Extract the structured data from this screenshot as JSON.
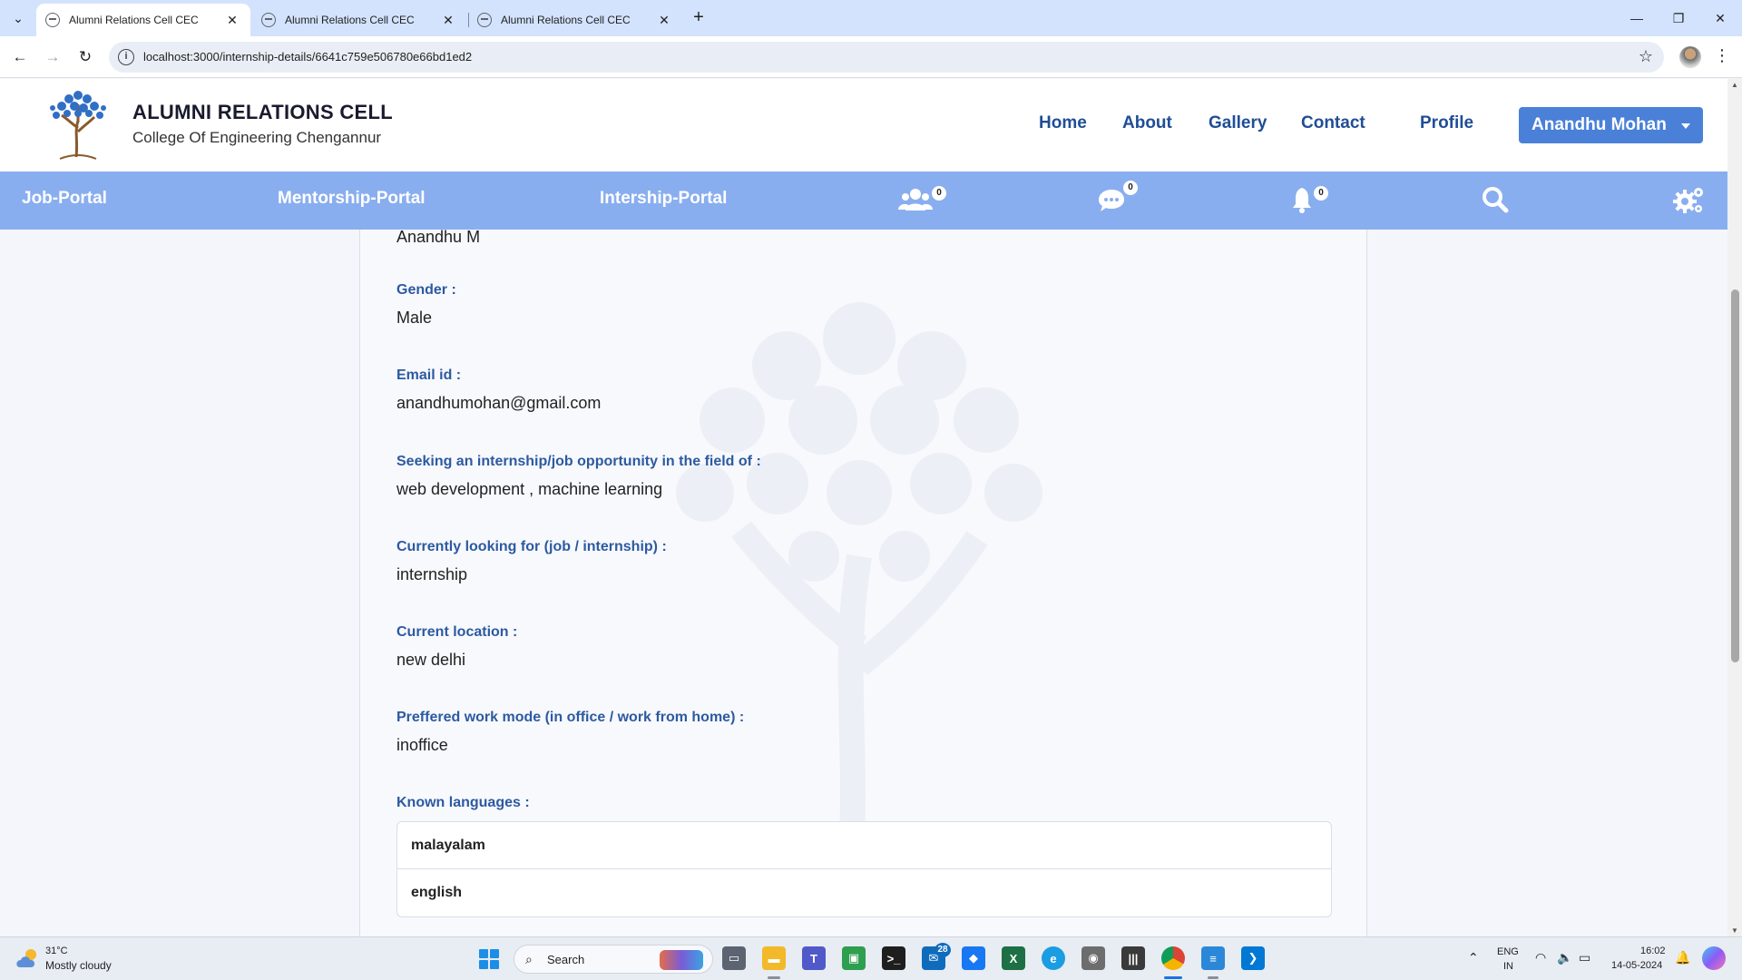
{
  "browser": {
    "tabs": [
      {
        "title": "Alumni Relations Cell CEC",
        "active": true
      },
      {
        "title": "Alumni Relations Cell CEC",
        "active": false
      },
      {
        "title": "Alumni Relations Cell CEC",
        "active": false
      }
    ],
    "url": "localhost:3000/internship-details/6641c759e506780e66bd1ed2",
    "icons": {
      "back": "←",
      "forward": "→",
      "reload": "↻",
      "star": "☆",
      "menu": "⋮",
      "new_tab": "+",
      "close": "✕",
      "minimize": "—",
      "maximize": "❐",
      "window_close": "✕",
      "tab_search": "⌄"
    }
  },
  "header": {
    "title": "ALUMNI RELATIONS CELL",
    "subtitle": "College Of Engineering Chengannur",
    "nav": [
      "Home",
      "About",
      "Gallery",
      "Contact",
      "Profile"
    ],
    "user": "Anandhu Mohan"
  },
  "portal_bar": {
    "links": [
      "Job-Portal",
      "Mentorship-Portal",
      "Intership-Portal"
    ],
    "badges": {
      "connections": "0",
      "messages": "0",
      "notifications": "0"
    }
  },
  "details": {
    "name": "Anandhu M",
    "fields": [
      {
        "label": "Gender :",
        "value": "Male"
      },
      {
        "label": "Email id :",
        "value": "anandhumohan@gmail.com"
      },
      {
        "label": "Seeking an internship/job opportunity in the field of :",
        "value": "web development , machine learning"
      },
      {
        "label": "Currently looking for (job / internship) :",
        "value": "internship"
      },
      {
        "label": "Current location :",
        "value": "new delhi"
      },
      {
        "label": "Preffered work mode (in office / work from home) :",
        "value": "inoffice"
      }
    ],
    "languages_label": "Known languages :",
    "languages": [
      "malayalam",
      "english"
    ]
  },
  "taskbar": {
    "weather_temp": "31°C",
    "weather_desc": "Mostly cloudy",
    "search": "Search",
    "mail_badge": "28",
    "lang_1": "ENG",
    "lang_2": "IN",
    "time": "16:02",
    "date": "14-05-2024"
  },
  "colors": {
    "accent": "#89aeef",
    "label": "#2c5aa0",
    "nav": "#1f4e96",
    "button": "#4a80d8"
  }
}
